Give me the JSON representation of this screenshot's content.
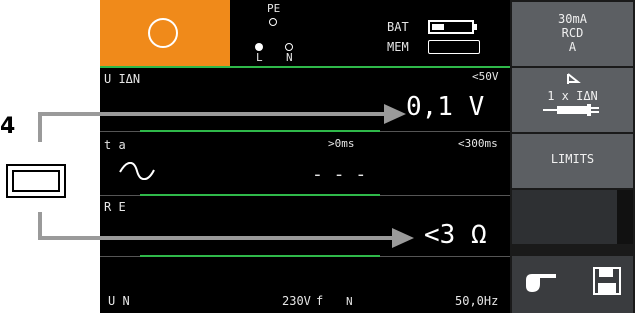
{
  "annotation": {
    "label": "4"
  },
  "status": {
    "pe": "PE",
    "l": "L",
    "n": "N",
    "bat": "BAT",
    "mem": "MEM"
  },
  "measure": {
    "u_label": "U IΔN",
    "u_limit": "<50V",
    "u_value": "0,1  V",
    "t_label": "t a",
    "t_limit1": ">0ms",
    "t_limit2": "<300ms",
    "t_value": "- - -",
    "r_label": "R E",
    "r_value": "<3  Ω",
    "un_label": "U N",
    "un_value": "230V",
    "f_label": "f",
    "n_label": "N",
    "f_value": "50,0Hz"
  },
  "side": {
    "rcd_current": "30mA",
    "rcd": "RCD",
    "rcd_type": "A",
    "mult": "1 x IΔN",
    "limits": "LIMITS"
  },
  "colors": {
    "accent": "#f08a1a",
    "line": "#2fb84a",
    "button": "#5c5f63"
  },
  "icons": [
    "circle-icon",
    "wave-icon",
    "plug-icon",
    "hand-pointer-icon",
    "save-disk-icon",
    "sine-icon"
  ]
}
